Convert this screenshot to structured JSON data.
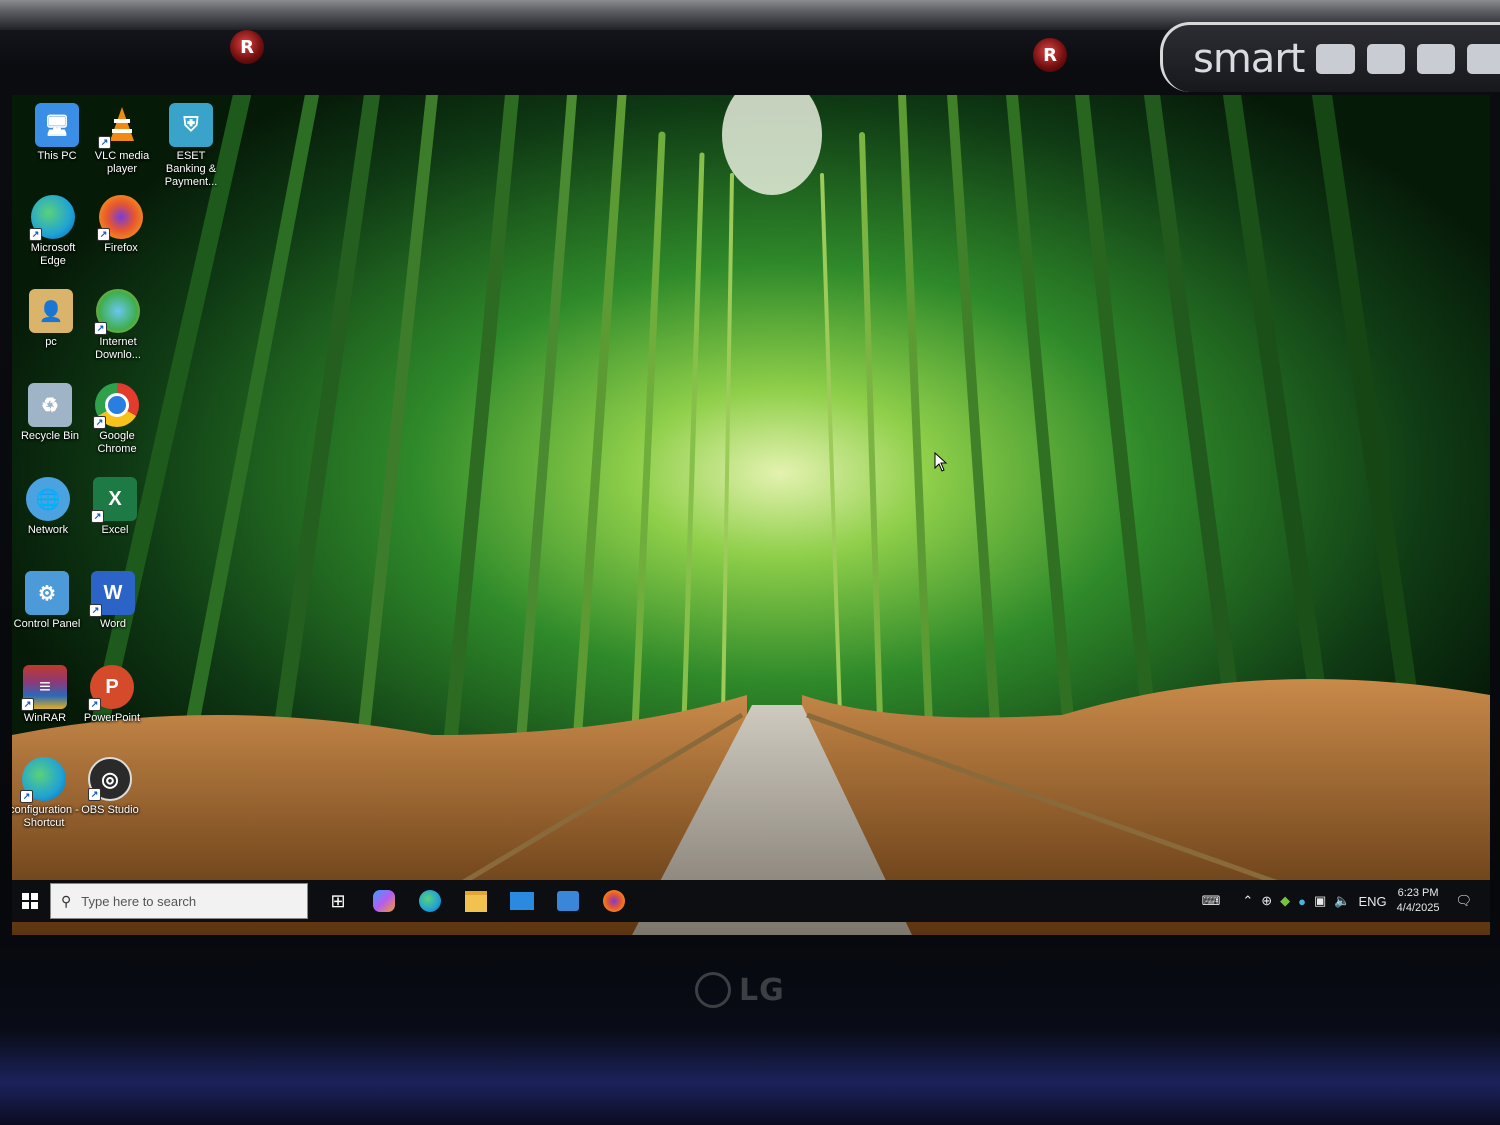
{
  "monitor": {
    "brand": "LG",
    "badge_text": "smart",
    "emblem_glyph": "R"
  },
  "desktop": {
    "wallpaper": "bamboo forest path",
    "icons": [
      {
        "label": "This PC",
        "icon": "this-pc-icon",
        "color": "#3a8ee6"
      },
      {
        "label": "VLC media player",
        "icon": "vlc-icon",
        "color": "#f08a12"
      },
      {
        "label": "ESET Banking & Payment...",
        "icon": "eset-icon",
        "color": "#3aa3c9"
      },
      {
        "label": "Microsoft Edge",
        "icon": "edge-icon",
        "color": "#1fa2d6"
      },
      {
        "label": "Firefox",
        "icon": "firefox-icon",
        "color": "#e8582a"
      },
      {
        "label": "pc",
        "icon": "user-folder-icon",
        "color": "#d9b46a"
      },
      {
        "label": "Internet Downlo...",
        "icon": "idm-icon",
        "color": "#3fae4c"
      },
      {
        "label": "Recycle Bin",
        "icon": "recycle-bin-icon",
        "color": "#9fb4c6"
      },
      {
        "label": "Google Chrome",
        "icon": "chrome-icon",
        "color": "#e33b2e"
      },
      {
        "label": "Network",
        "icon": "network-icon",
        "color": "#4aa3e0"
      },
      {
        "label": "Excel",
        "icon": "excel-icon",
        "color": "#1d7a45"
      },
      {
        "label": "Control Panel",
        "icon": "control-panel-icon",
        "color": "#4c9ad8"
      },
      {
        "label": "Word",
        "icon": "word-icon",
        "color": "#2b64c6"
      },
      {
        "label": "WinRAR",
        "icon": "winrar-icon",
        "color": "#8a3a7a"
      },
      {
        "label": "PowerPoint",
        "icon": "powerpoint-icon",
        "color": "#d44a2a"
      },
      {
        "label": "configuration - Shortcut",
        "icon": "edge-shortcut-icon",
        "color": "#1fa2d6"
      },
      {
        "label": "OBS Studio",
        "icon": "obs-icon",
        "color": "#3a3a3a"
      }
    ]
  },
  "taskbar": {
    "search_placeholder": "Type here to search",
    "pinned_apps": [
      "task-view-icon",
      "copilot-icon",
      "edge-icon",
      "file-explorer-icon",
      "mail-icon",
      "store-icon",
      "firefox-icon"
    ],
    "tray": {
      "language": "ENG",
      "time": "6:23 PM",
      "date": "4/4/2025"
    }
  }
}
